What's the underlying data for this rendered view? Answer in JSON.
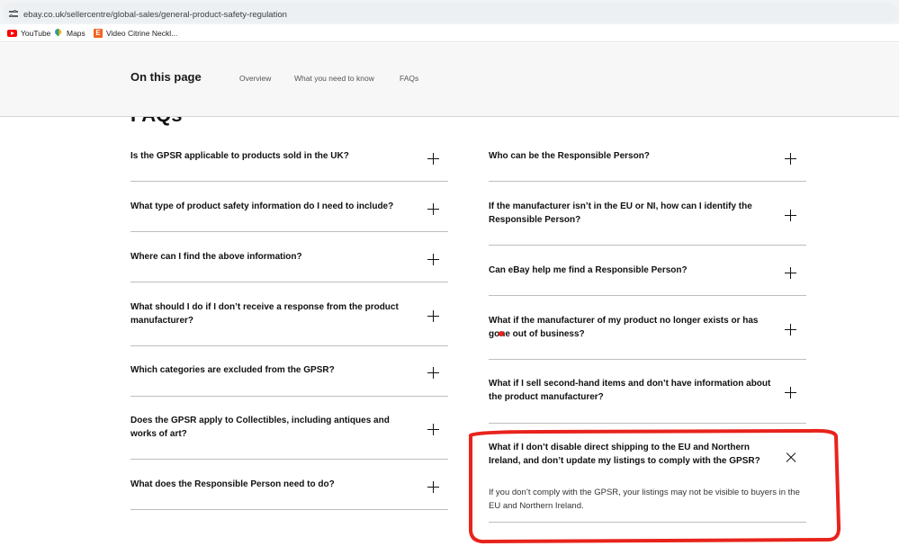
{
  "browser": {
    "url": "ebay.co.uk/sellercentre/global-sales/general-product-safety-regulation",
    "bookmarks": [
      {
        "label": "YouTube",
        "icon": "youtube-icon"
      },
      {
        "label": "Maps",
        "icon": "maps-icon"
      },
      {
        "label": "Video Citrine Neckl...",
        "icon": "etsy-icon",
        "icon_text": "E"
      }
    ]
  },
  "page_nav": {
    "title": "On this page",
    "links": [
      "Overview",
      "What you need to know",
      "FAQs"
    ]
  },
  "main": {
    "heading": "FAQs",
    "left_faqs": [
      {
        "question": "Is the GPSR applicable to products sold in the UK?"
      },
      {
        "question": "What type of product safety information do I need to include?"
      },
      {
        "question": "Where can I find the above information?"
      },
      {
        "question": "What should I do if I don’t receive a response from the product manufacturer?"
      },
      {
        "question": "Which categories are excluded from the GPSR?"
      },
      {
        "question": "Does the GPSR apply to Collectibles, including antiques and works of art?"
      },
      {
        "question": "What does the Responsible Person need to do?"
      }
    ],
    "right_faqs": [
      {
        "question": "Who can be the Responsible Person?"
      },
      {
        "question": "If the manufacturer isn’t in the EU or NI, how can I identify the Responsible Person?"
      },
      {
        "question": "Can eBay help me find a Responsible Person?"
      },
      {
        "question": "What if the manufacturer of my product no longer exists or has gone out of business?"
      },
      {
        "question": "What if I sell second-hand items and don’t have information about the product manufacturer?"
      },
      {
        "question": "What if I don’t disable direct shipping to the EU and Northern Ireland, and don’t update my listings to comply with the GPSR?",
        "answer": "If you don’t comply with the GPSR, your listings may not be visible to buyers in the EU and Northern Ireland.",
        "expanded": true
      }
    ]
  },
  "colors": {
    "highlight_annotation": "#e8231c",
    "nav_background": "#f7f7f7",
    "divider": "#bdbdbd"
  }
}
